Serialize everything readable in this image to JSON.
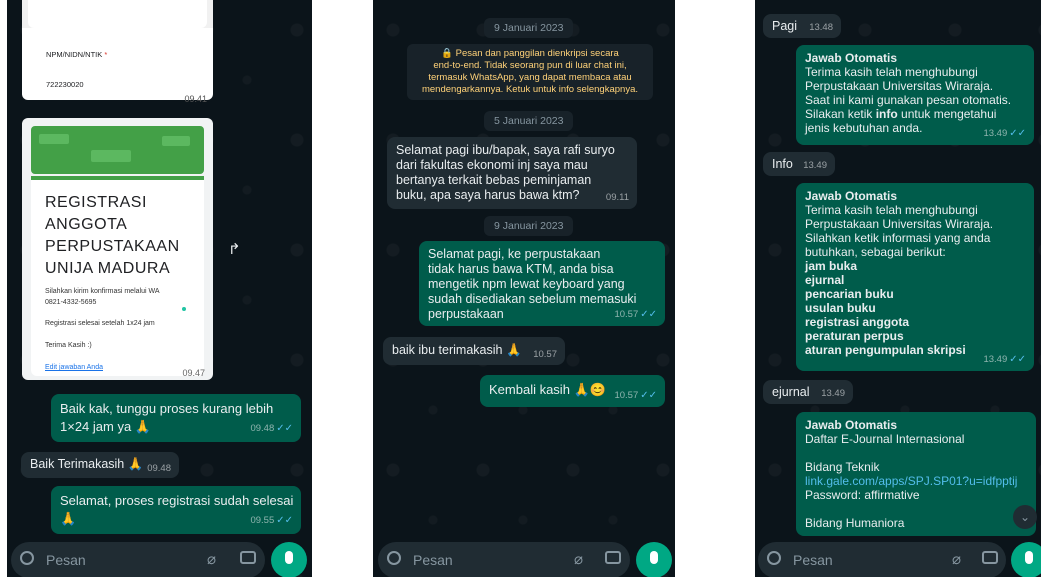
{
  "composer": {
    "placeholder": "Pesan"
  },
  "screen1": {
    "form_field_label": "NPM/NIDN/NTIK",
    "form_field_required": "*",
    "form_field_value": "722230020",
    "form_card_time": "09.41",
    "reg_title_lines": [
      "REGISTRASI",
      "ANGGOTA",
      "PERPUSTAKAAN",
      "UNIJA MADURA"
    ],
    "reg_info1": "Silahkan kirim konfirmasi melalui WA",
    "reg_info2": "0821-4332-5695",
    "reg_info3": "Registrasi selesai setelah 1x24 jam",
    "reg_info4": "Terima Kasih :)",
    "reg_link": "Edit jawaban Anda",
    "reg_time": "09.47",
    "msg1_lines": [
      "Baik kak, tunggu proses kurang lebih",
      "1×24 jam ya 🙏"
    ],
    "msg1_time": "09.48",
    "msg2_text": "Baik Terimakasih 🙏",
    "msg2_time": "09.48",
    "msg3_lines": [
      "Selamat, proses registrasi sudah selesai",
      "🙏"
    ],
    "msg3_time": "09.55"
  },
  "screen2": {
    "date_top": "9 Januari 2023",
    "encryption_lines": [
      "🔒 Pesan dan panggilan dienkripsi secara",
      "end-to-end. Tidak seorang pun di luar chat ini,",
      "termasuk WhatsApp, yang dapat membaca atau",
      "mendengarkannya. Ketuk untuk info selengkapnya."
    ],
    "date_mid": "5 Januari 2023",
    "msg1_lines": [
      "Selamat pagi ibu/bapak, saya  rafi suryo",
      "dari fakultas ekonomi inj saya mau",
      "bertanya terkait bebas peminjaman",
      "buku, apa saya harus bawa ktm?"
    ],
    "msg1_time": "09.11",
    "date_bottom": "9 Januari 2023",
    "msg2_lines": [
      "Selamat pagi,  ke perpustakaan",
      "tidak harus bawa KTM, anda bisa",
      "mengetik npm lewat keyboard yang",
      "sudah disediakan sebelum memasuki",
      "perpustakaan"
    ],
    "msg2_time": "10.57",
    "msg3_text": "baik ibu terimakasih 🙏",
    "msg3_time": "10.57",
    "msg4_text": "Kembali kasih 🙏😊",
    "msg4_time": "10.57"
  },
  "screen3": {
    "msg_pagi": "Pagi",
    "msg_pagi_time": "13.48",
    "auto1_title": "Jawab Otomatis",
    "auto1_lines": [
      "Terima kasih telah menghubungi",
      "Perpustakaan Universitas Wiraraja.",
      "Saat ini kami gunakan pesan otomatis."
    ],
    "auto1_pre": "Silakan ketik ",
    "auto1_bold": "info",
    "auto1_post": " untuk mengetahui",
    "auto1_last": "jenis kebutuhan anda.",
    "auto1_time": "13.49",
    "msg_info": "Info",
    "msg_info_time": "13.49",
    "auto2_title": "Jawab Otomatis",
    "auto2_lines": [
      "Terima kasih telah menghubungi",
      "Perpustakaan Universitas Wiraraja.",
      "Silahkan ketik informasi yang anda",
      "butuhkan, sebagai berikut:"
    ],
    "auto2_options": [
      "jam buka",
      "ejurnal",
      "pencarian buku",
      "usulan buku",
      "registrasi anggota",
      "peraturan perpus",
      "aturan pengumpulan skripsi"
    ],
    "auto2_time": "13.49",
    "msg_ejurnal": "ejurnal",
    "msg_ejurnal_time": "13.49",
    "auto3_title": "Jawab Otomatis",
    "auto3_subtitle": "Daftar E-Journal Internasional",
    "auto3_section1": "Bidang Teknik",
    "auto3_link1": "link.gale.com/apps/SPJ.SP01?u=idfpptij",
    "auto3_password1": "Password: affirmative",
    "auto3_section2": "Bidang Humaniora"
  },
  "colors": {
    "chat_bg": "#0b141a",
    "incoming": "#202c33",
    "outgoing": "#005c4b",
    "accent": "#00a884",
    "read_tick": "#53bdeb"
  }
}
